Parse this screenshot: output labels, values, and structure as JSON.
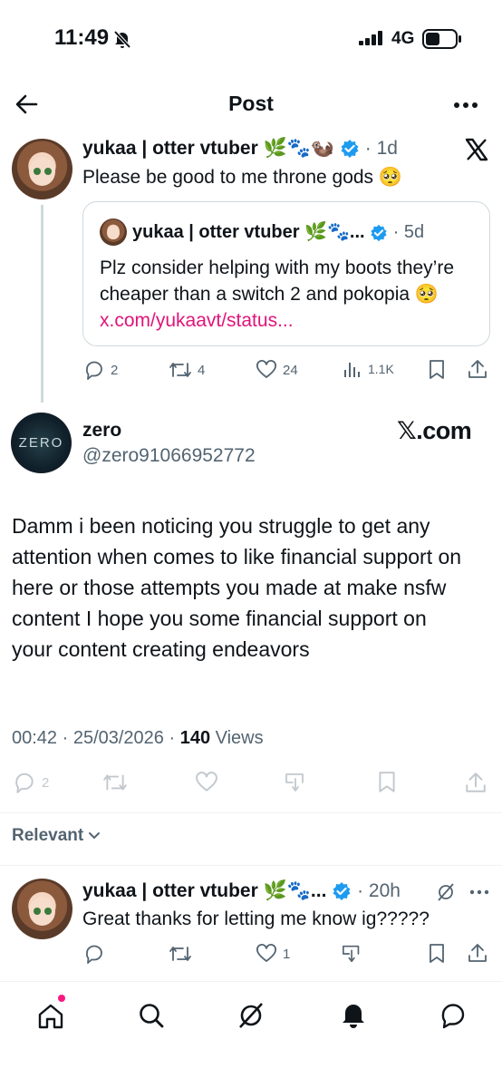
{
  "status_bar": {
    "time": "11:49",
    "network": "4G"
  },
  "header": {
    "title": "Post"
  },
  "post": {
    "author": "yukaa | otter vtuber 🌿🐾🦦",
    "time": "1d",
    "text": "Please be good to me throne gods 🥺",
    "quote": {
      "author": "yukaa | otter vtuber 🌿🐾...",
      "time": "5d",
      "text": "Plz consider helping with my boots they’re cheaper than a switch 2 and pokopia 🥺 ",
      "link": "x.com/yukaavt/status..."
    },
    "stats": {
      "replies": "2",
      "reposts": "4",
      "likes": "24",
      "views": "1.1K"
    }
  },
  "main": {
    "author": "zero",
    "handle": "@zero91066952772",
    "avatar_text": "ZERO",
    "watermark": "𝕏.com",
    "text": "Damm i been noticing you struggle to get any attention when comes to like financial support on here or those attempts you made at make nsfw content I hope you some financial support on your content creating endeavors",
    "timestamp": "00:42 · 25/03/2026 · ",
    "views_count": "140",
    "views_label": " Views",
    "reply_count": "2"
  },
  "sort": {
    "label": "Relevant"
  },
  "reply": {
    "author": "yukaa | otter vtuber 🌿🐾...",
    "time": "20h",
    "text": "Great thanks for letting me know ig?????",
    "likes": "1"
  },
  "colors": {
    "accent": "#1d9bf0",
    "link": "#e1147a",
    "muted": "#536471",
    "notification_dot": "#f91880"
  },
  "icons": {
    "back": "arrow-left-icon",
    "more": "more-horizontal-icon",
    "x_logo": "x-logo-icon",
    "reply": "reply-icon",
    "repost": "repost-icon",
    "like": "heart-icon",
    "views": "views-icon",
    "bookmark": "bookmark-icon",
    "share": "share-icon",
    "tip": "tip-icon",
    "nav": [
      "home-icon",
      "search-icon",
      "grok-icon",
      "notifications-icon",
      "messages-icon"
    ]
  }
}
